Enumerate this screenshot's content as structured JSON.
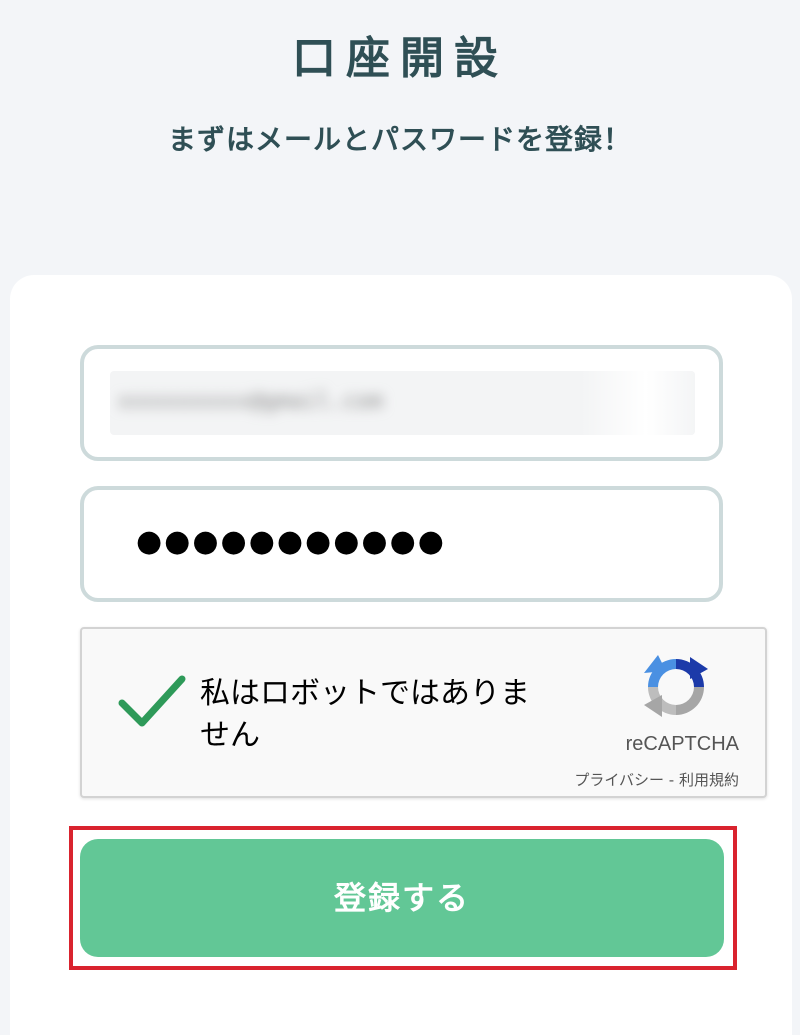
{
  "header": {
    "title": "口座開設",
    "subtitle": "まずはメールとパスワードを登録！"
  },
  "form": {
    "email_value": "xxxxxxxxxx@gmail.com",
    "password_value": "●●●●●●●●●●●",
    "recaptcha": {
      "label": "私はロボットではありません",
      "brand": "reCAPTCHA",
      "privacy": "プライバシー",
      "separator": " - ",
      "terms": "利用規約",
      "checked": true
    },
    "submit_label": "登録する"
  },
  "colors": {
    "title": "#2f4f55",
    "submit_button": "#62c796",
    "field_border": "#cddadb",
    "highlight": "#d9232e",
    "check": "#2e9a59"
  }
}
